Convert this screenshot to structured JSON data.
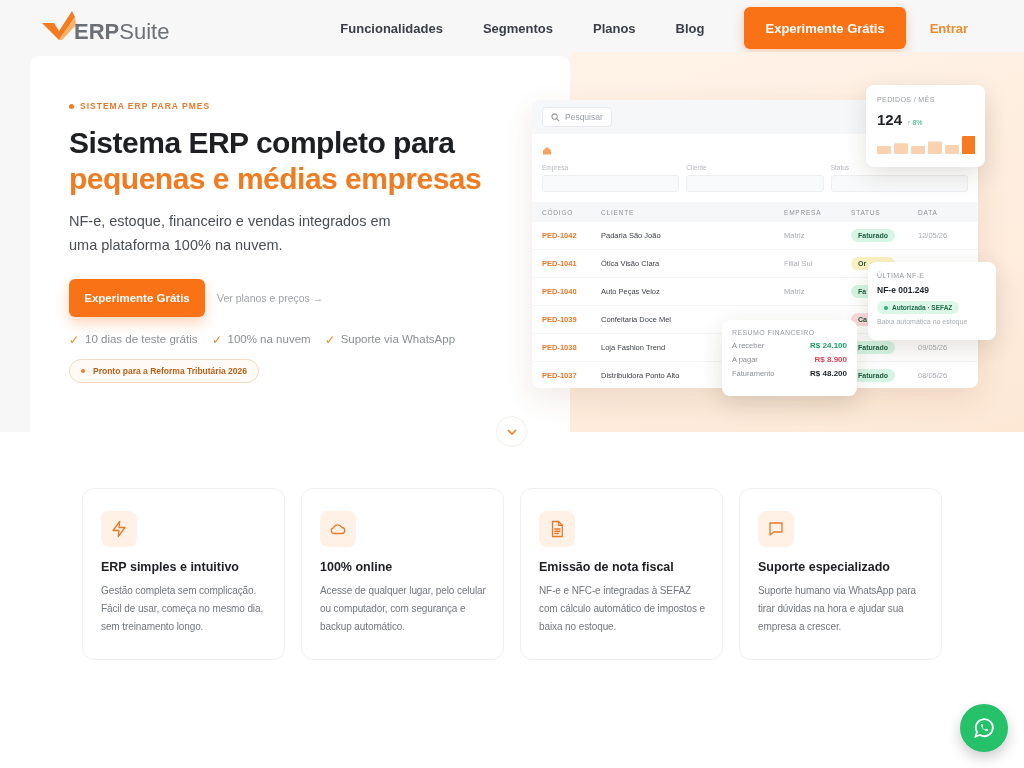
{
  "nav": {
    "logo": "**ERP**Suite",
    "links": [
      "Funcionalidades",
      "Segmentos",
      "Planos",
      "Blog"
    ],
    "cta": "Experimente Grátis",
    "login": "Entrar"
  },
  "hero": {
    "eyebrow": "SISTEMA ERP PARA PMES",
    "title_line1": "Sistema ERP completo para",
    "title_line2": "pequenas e médias empresas",
    "subtitle": "NF-e, estoque, financeiro e vendas integrados em uma plataforma 100% na nuvem.",
    "primary_button": "Experimente Grátis",
    "secondary_link": "Ver planos e preços →",
    "checks": [
      {
        "mark": "✓",
        "text": "10 dias de teste grátis"
      },
      {
        "mark": "✓",
        "text": "100% na nuvem"
      },
      {
        "mark": "✓",
        "text": "Suporte via WhatsApp"
      }
    ],
    "badge": "Pronto para a Reforma Tributária 2026"
  },
  "mockup": {
    "search_placeholder": "Pesquisar",
    "filters": [
      "Empresa",
      "Cliente",
      "Status"
    ],
    "columns": [
      "CÓDIGO",
      "CLIENTE",
      "EMPRESA",
      "STATUS",
      "DATA"
    ],
    "rows": [
      {
        "code": "PED-1042",
        "client": "Padaria São João",
        "company": "Matriz",
        "status": {
          "label": "Faturado",
          "color": "#d6f5e4"
        },
        "date": "12/05/26"
      },
      {
        "code": "PED-1041",
        "client": "Ótica Visão Clara",
        "company": "Filial Sul",
        "status": {
          "label": "Or",
          "color": "#fdf0c2"
        }
      },
      {
        "code": "PED-1040",
        "client": "Auto Peças Veloz",
        "company": "Matriz",
        "status": {
          "label": "Fa",
          "color": "#d6f5e4"
        }
      },
      {
        "code": "PED-1039",
        "client": "Confeitaria Doce Mel",
        "status": {
          "label": "Ca",
          "color": "#fbdcdc"
        }
      },
      {
        "code": "PED-1038",
        "client": "Loja Fashion Trend",
        "status": {
          "label": "Faturado",
          "color": "#d6f5e4"
        },
        "date": "09/05/26"
      },
      {
        "code": "PED-1037",
        "client": "Distribuidora Ponto Alto",
        "status": {
          "label": "Faturado",
          "color": "#d6f5e4"
        },
        "date": "08/05/26"
      }
    ],
    "orders_card": {
      "label": "PEDIDOS / MÊS",
      "value": "124",
      "change": "↑ 8%"
    },
    "invoice_card": {
      "label": "ÚLTIMA NF-E",
      "number": "NF-e 001.249",
      "status": "Autorizada · SEFAZ",
      "note": "Baixa automática no estoque"
    },
    "finance_card": {
      "title": "RESUMO FINANCEIRO",
      "rows": [
        {
          "label": "A receber",
          "value": "R$ 24.100",
          "color": "#1aa260"
        },
        {
          "label": "A pagar",
          "value": "R$ 8.900",
          "color": "#e0434b"
        },
        {
          "label": "Faturamento",
          "value": "R$ 48.200",
          "color": "#1f2328"
        }
      ]
    }
  },
  "features": [
    {
      "kind": "bolt",
      "title": "ERP simples e intuitivo",
      "text": "Gestão completa sem complicação. Fácil de usar, começa no mesmo dia, sem treinamento longo."
    },
    {
      "kind": "cloud",
      "title": "100% online",
      "text": "Acesse de qualquer lugar, pelo celular ou computador, com segurança e backup automático."
    },
    {
      "kind": "document",
      "title": "Emissão de nota fiscal",
      "text": "NF-e e NFC-e integradas à SEFAZ com cálculo automático de impostos e baixa no estoque."
    },
    {
      "kind": "chat",
      "title": "Suporte especializado",
      "text": "Suporte humano via WhatsApp para tirar dúvidas na hora e ajudar sua empresa a crescer."
    }
  ]
}
